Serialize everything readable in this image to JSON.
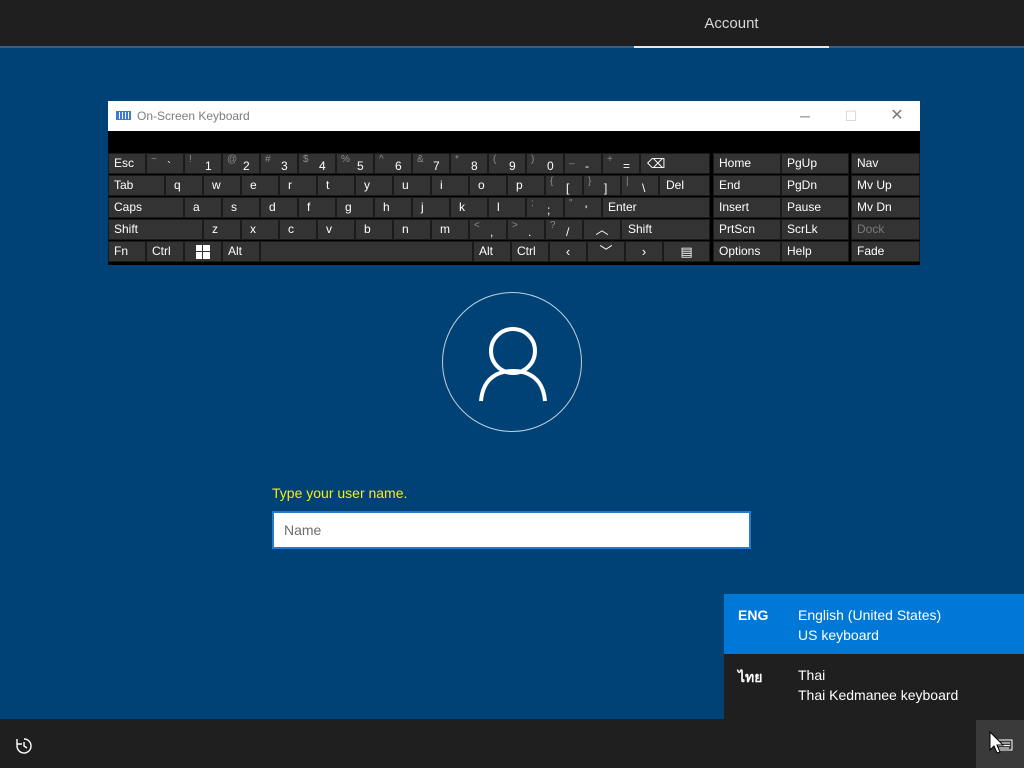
{
  "header": {
    "tab_account": "Account"
  },
  "osk": {
    "title": "On-Screen Keyboard",
    "keys": {
      "esc": "Esc",
      "tab": "Tab",
      "caps": "Caps",
      "shift_l": "Shift",
      "fn": "Fn",
      "ctrl_l": "Ctrl",
      "alt_l": "Alt",
      "alt_r": "Alt",
      "ctrl_r": "Ctrl",
      "shift_r": "Shift",
      "enter": "Enter",
      "del": "Del",
      "home": "Home",
      "pgup": "PgUp",
      "nav": "Nav",
      "end": "End",
      "pgdn": "PgDn",
      "mvup": "Mv Up",
      "insert": "Insert",
      "pause": "Pause",
      "mvdn": "Mv Dn",
      "prtscn": "PrtScn",
      "scrlk": "ScrLk",
      "dock": "Dock",
      "options": "Options",
      "help": "Help",
      "fade": "Fade",
      "q": "q",
      "w": "w",
      "e": "e",
      "r": "r",
      "t": "t",
      "y": "y",
      "u": "u",
      "i": "i",
      "o": "o",
      "p": "p",
      "a": "a",
      "s": "s",
      "d": "d",
      "f": "f",
      "g": "g",
      "h": "h",
      "j": "j",
      "k": "k",
      "l": "l",
      "z": "z",
      "x": "x",
      "c": "c",
      "v": "v",
      "b": "b",
      "n": "n",
      "m": "m"
    },
    "number_row": [
      {
        "shift": "~",
        "main": "`"
      },
      {
        "shift": "!",
        "main": "1"
      },
      {
        "shift": "@",
        "main": "2"
      },
      {
        "shift": "#",
        "main": "3"
      },
      {
        "shift": "$",
        "main": "4"
      },
      {
        "shift": "%",
        "main": "5"
      },
      {
        "shift": "^",
        "main": "6"
      },
      {
        "shift": "&",
        "main": "7"
      },
      {
        "shift": "*",
        "main": "8"
      },
      {
        "shift": "(",
        "main": "9"
      },
      {
        "shift": ")",
        "main": "0"
      },
      {
        "shift": "_",
        "main": "-"
      },
      {
        "shift": "+",
        "main": "="
      }
    ],
    "punct": {
      "lbracket": {
        "shift": "{",
        "main": "["
      },
      "rbracket": {
        "shift": "}",
        "main": "]"
      },
      "backslash": {
        "shift": "|",
        "main": "\\"
      },
      "semicolon": {
        "shift": ":",
        "main": ";"
      },
      "quote": {
        "shift": "\"",
        "main": "'"
      },
      "comma": {
        "shift": "<",
        "main": ","
      },
      "period": {
        "shift": ">",
        "main": "."
      },
      "slash": {
        "shift": "?",
        "main": "/"
      }
    }
  },
  "login": {
    "prompt": "Type your user name.",
    "name_placeholder": "Name"
  },
  "language_menu": {
    "items": [
      {
        "code": "ENG",
        "name": "English (United States)",
        "keyboard": "US keyboard",
        "selected": true
      },
      {
        "code": "ไทย",
        "name": "Thai",
        "keyboard": "Thai Kedmanee keyboard",
        "selected": false
      }
    ]
  },
  "colors": {
    "background": "#004275",
    "accent": "#0078d7",
    "prompt": "#f4f00a",
    "bar": "#1f1f1f"
  }
}
